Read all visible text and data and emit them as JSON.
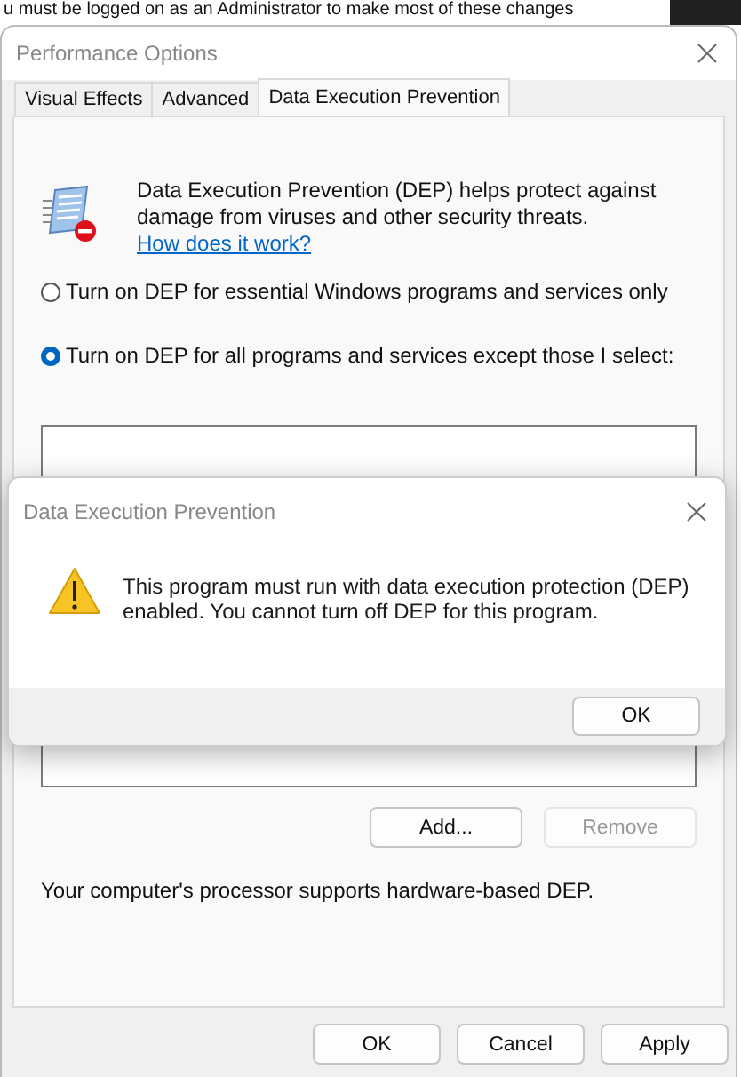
{
  "background_text": "u must be logged on as an Administrator to make most of these changes",
  "window": {
    "title": "Performance Options"
  },
  "tabs": [
    {
      "label": "Visual Effects",
      "selected": false
    },
    {
      "label": "Advanced",
      "selected": false
    },
    {
      "label": "Data Execution Prevention",
      "selected": true
    }
  ],
  "description": "Data Execution Prevention (DEP) helps protect against damage from viruses and other security threats.",
  "help_link": "How does it work?",
  "options": [
    {
      "label": "Turn on DEP for essential Windows programs and services only",
      "selected": false
    },
    {
      "label": "Turn on DEP for all programs and services except those I select:",
      "selected": true
    }
  ],
  "list_buttons": [
    {
      "label": "Add...",
      "disabled": false
    },
    {
      "label": "Remove",
      "disabled": true
    }
  ],
  "processor_note": "Your computer's processor supports hardware-based DEP.",
  "buttons": [
    "OK",
    "Cancel",
    "Apply"
  ],
  "dialog": {
    "title": "Data Execution Prevention",
    "message": "This program must run with data execution protection (DEP) enabled. You cannot turn off DEP for this program.",
    "button": "OK"
  }
}
